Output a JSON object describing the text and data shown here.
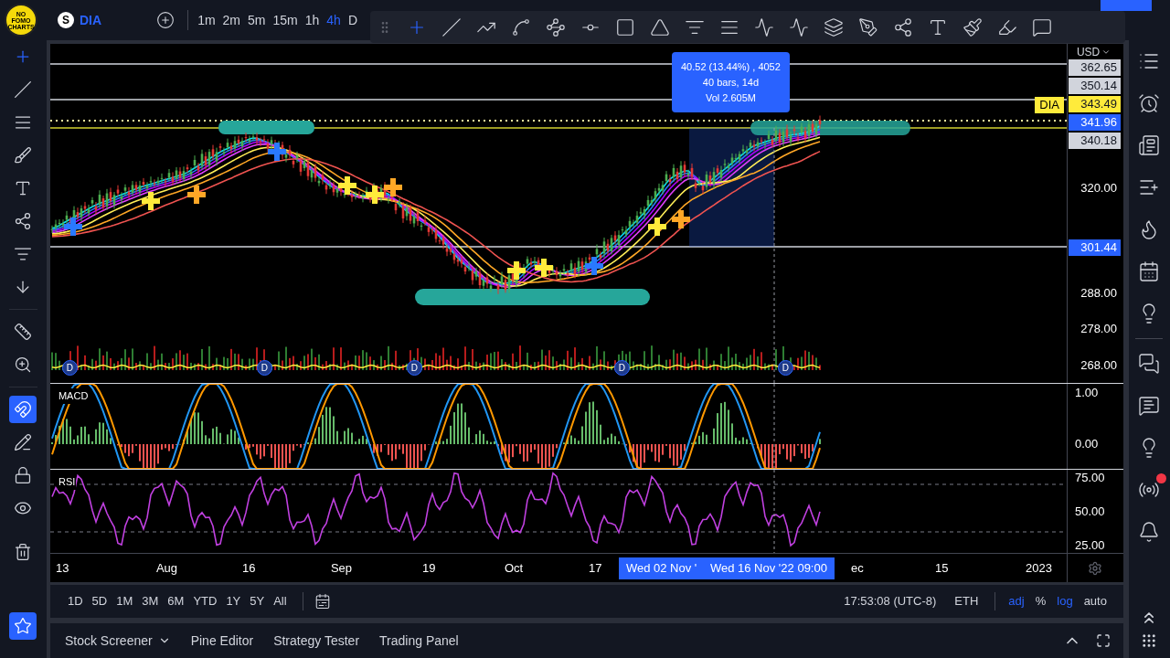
{
  "brand": {
    "logo_text": "NO FOMO CHARTS"
  },
  "symbol": {
    "badge": "S",
    "ticker": "DIA"
  },
  "timeframes": [
    {
      "label": "1m",
      "selected": false
    },
    {
      "label": "2m",
      "selected": false
    },
    {
      "label": "5m",
      "selected": false
    },
    {
      "label": "15m",
      "selected": false
    },
    {
      "label": "1h",
      "selected": false
    },
    {
      "label": "4h",
      "selected": true
    },
    {
      "label": "D",
      "selected": false
    }
  ],
  "drawing_toolbar": [
    {
      "selected": true
    },
    {
      "selected": false
    },
    {
      "selected": false
    },
    {
      "selected": false
    },
    {
      "selected": false
    },
    {
      "selected": false
    },
    {
      "selected": false
    },
    {
      "selected": false
    },
    {
      "selected": false
    },
    {
      "selected": false
    },
    {
      "selected": false
    },
    {
      "selected": false
    },
    {
      "selected": false
    },
    {
      "selected": false
    },
    {
      "selected": false
    },
    {
      "selected": false
    },
    {
      "selected": false
    },
    {
      "selected": false
    },
    {
      "selected": false
    }
  ],
  "left_toolbar": [
    {
      "kind": "tool",
      "selected": true
    },
    {
      "kind": "tool",
      "selected": false
    },
    {
      "kind": "tool",
      "selected": false
    },
    {
      "kind": "tool",
      "selected": false
    },
    {
      "kind": "tool",
      "selected": false
    },
    {
      "kind": "tool",
      "selected": false
    },
    {
      "kind": "tool",
      "selected": false
    },
    {
      "kind": "tool",
      "selected": false
    },
    {
      "kind": "tool",
      "selected": false
    },
    {
      "kind": "tool",
      "selected": false
    },
    {
      "kind": "toggle",
      "selected": true
    },
    {
      "kind": "toggle",
      "selected": false
    },
    {
      "kind": "toggle",
      "selected": false
    },
    {
      "kind": "toggle",
      "selected": false
    },
    {
      "kind": "tool",
      "selected": false
    },
    {
      "kind": "toggle",
      "selected": true
    }
  ],
  "price_axis": {
    "currency": "USD",
    "labels": [
      {
        "text": "362.65",
        "kind": "tag",
        "color": "#d1d4dc"
      },
      {
        "text": "350.14",
        "kind": "tag",
        "color": "#d1d4dc"
      },
      {
        "text": "343.49",
        "kind": "tag",
        "color": "#ffeb3b"
      },
      {
        "text": "341.96",
        "kind": "tag",
        "color": "#2962ff"
      },
      {
        "text": "340.18",
        "kind": "tag",
        "color": "#d1d4dc"
      },
      {
        "text": "320.00",
        "kind": "plain"
      },
      {
        "text": "301.44",
        "kind": "tag",
        "color": "#2962ff"
      },
      {
        "text": "288.00",
        "kind": "plain"
      },
      {
        "text": "278.00",
        "kind": "plain"
      },
      {
        "text": "268.00",
        "kind": "plain"
      }
    ]
  },
  "symbol_tag": "DIA",
  "measure_tooltip": [
    "40.52 (13.44%) , 4052",
    "40 bars, 14d",
    "Vol 2.605M"
  ],
  "dividend_markers": [
    "D",
    "D",
    "D",
    "D",
    "D"
  ],
  "panes": [
    {
      "title": "MACD",
      "axis": [
        "1.00",
        "0.00"
      ]
    },
    {
      "title": "RSI",
      "axis": [
        "75.00",
        "50.00",
        "25.00"
      ]
    }
  ],
  "time_axis": [
    {
      "text": "13",
      "highlighted": false
    },
    {
      "text": "Aug",
      "highlighted": false
    },
    {
      "text": "16",
      "highlighted": false
    },
    {
      "text": "Sep",
      "highlighted": false
    },
    {
      "text": "19",
      "highlighted": false
    },
    {
      "text": "Oct",
      "highlighted": false
    },
    {
      "text": "17",
      "highlighted": false
    },
    {
      "text": "Wed 02 Nov '",
      "highlighted": true
    },
    {
      "text": "Wed 16 Nov '22   09:00",
      "highlighted": true
    },
    {
      "text": "ec",
      "highlighted": false
    },
    {
      "text": "15",
      "highlighted": false
    },
    {
      "text": "2023",
      "highlighted": false
    }
  ],
  "ranges": [
    "1D",
    "5D",
    "1M",
    "3M",
    "6M",
    "YTD",
    "1Y",
    "5Y",
    "All"
  ],
  "clock": "17:53:08 (UTC-8)",
  "session": "ETH",
  "scale_options": [
    {
      "label": "adj",
      "on": true
    },
    {
      "label": "%",
      "on": false
    },
    {
      "label": "log",
      "on": true
    },
    {
      "label": "auto",
      "on": false
    }
  ],
  "bottom_tabs": [
    {
      "label": "Stock Screener",
      "dropdown": true
    },
    {
      "label": "Pine Editor",
      "dropdown": false
    },
    {
      "label": "Strategy Tester",
      "dropdown": false
    },
    {
      "label": "Trading Panel",
      "dropdown": false
    }
  ],
  "right_sidebar": {
    "alert_dot": true
  }
}
